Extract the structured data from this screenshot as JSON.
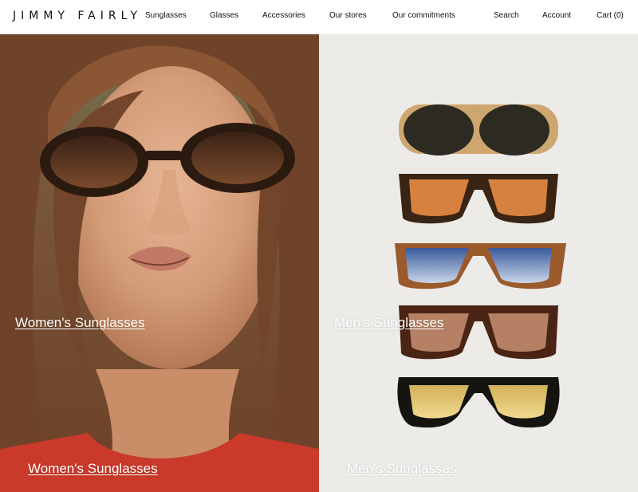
{
  "brand": {
    "name": "JIMMY FAIRLY"
  },
  "nav": {
    "sunglasses": "Sunglasses",
    "glasses": "Glasses",
    "accessories": "Accessories",
    "stores": "Our stores",
    "commitments": "Our commitments",
    "search": "Search",
    "account": "Account",
    "cart": "Cart (0)"
  },
  "hero": {
    "left": {
      "label": "Women's Sunglasses"
    },
    "right": {
      "label": "Men's Sunglasses"
    }
  },
  "colors": {
    "accent": "#111111",
    "link": "#ffffff",
    "dress": "#c93a2a"
  }
}
